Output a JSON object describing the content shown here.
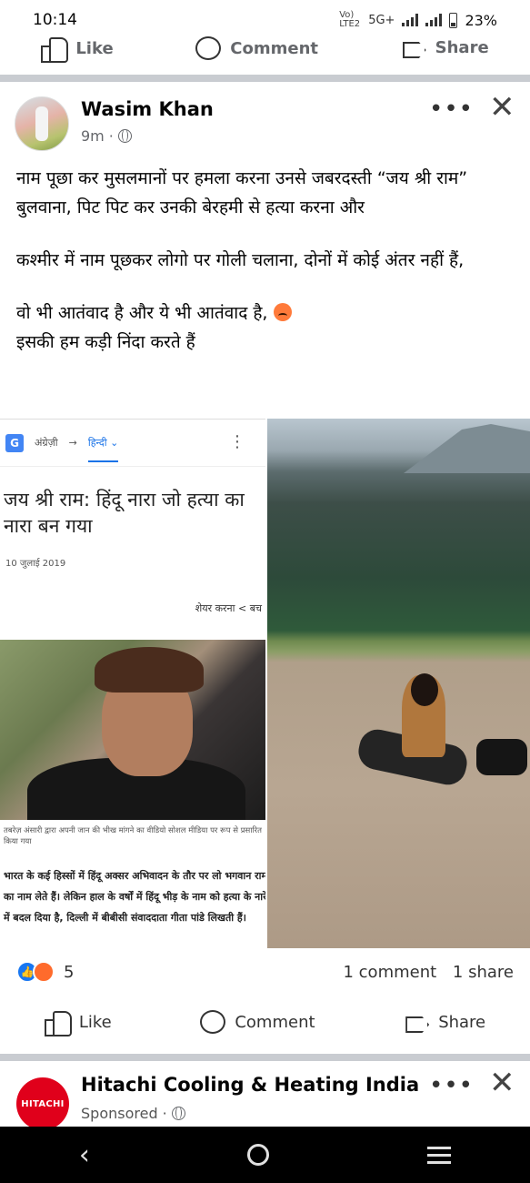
{
  "status_bar": {
    "time": "10:14",
    "network_label": "Vo) LTE2",
    "signal_label": "5G+",
    "battery_percent": "23%"
  },
  "previous_post_actions": {
    "like": "Like",
    "comment": "Comment",
    "share": "Share"
  },
  "post": {
    "author": "Wasim Khan",
    "time": "9m",
    "more_icon": "more-dots-icon",
    "close_icon": "close-icon",
    "text_lines": [
      "नाम पूछा कर मुसलमानों पर हमला करना उनसे जबरदस्ती “जय श्री राम” बुलवाना, पिट पिट कर उनकी बेरहमी से हत्या करना और",
      "कश्मीर में नाम पूछकर लोगो पर गोली चलाना, दोनों में कोई अंतर नहीं हैं,",
      "वो भी आतंवाद है और ये भी आतंवाद है,",
      "इसकी हम कड़ी निंदा करते हैं"
    ],
    "embedded_article": {
      "lang_from": "अंग्रेज़ी",
      "lang_arrow": "→",
      "lang_to": "हिन्दी",
      "headline": "जय श्री राम: हिंदू नारा जो हत्या का नारा बन गया",
      "date": "10 जुलाई 2019",
      "share_label": "शेयर करना",
      "share_tail": "बच",
      "caption": "तबरेज़ अंसारी द्वारा अपनी जान की भीख मांगने का वीडियो सोशल मीडिया पर रूप से प्रसारित किया गया",
      "body": "भारत के कई हिस्सों में हिंदू अक्सर अभिवादन के तौर पर लो भगवान राम का नाम लेते हैं। लेकिन हाल के वर्षों में हिंदू भीड़ के नाम को हत्या के नारे में बदल दिया है, दिल्ली में बीबीसी संवाददाता गीता पांडे लिखती हैं।"
    },
    "reactions": {
      "count": "5",
      "comments": "1 comment",
      "shares": "1 share"
    },
    "actions": {
      "like": "Like",
      "comment": "Comment",
      "share": "Share"
    }
  },
  "sponsored_post": {
    "name": "Hitachi Cooling & Heating India",
    "label": "Sponsored",
    "logo_text": "HITACHI"
  },
  "nav": {
    "back_icon": "back-chevron-icon",
    "home_icon": "home-circle-icon",
    "recents_icon": "recents-menu-icon"
  }
}
